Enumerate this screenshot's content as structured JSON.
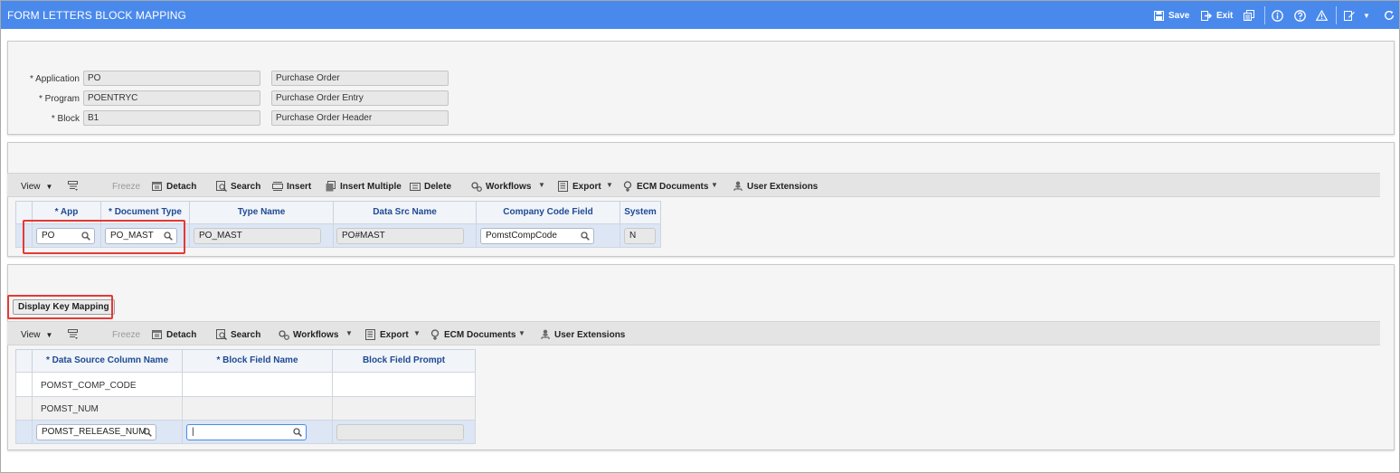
{
  "window": {
    "title": "FORM LETTERS BLOCK MAPPING",
    "save_label": "Save",
    "exit_label": "Exit"
  },
  "header_form": {
    "application_label": "* Application",
    "application_value": "PO",
    "application_desc": "Purchase Order",
    "program_label": "* Program",
    "program_value": "POENTRYC",
    "program_desc": "Purchase Order Entry",
    "block_label": "* Block",
    "block_value": "B1",
    "block_desc": "Purchase Order Header"
  },
  "toolbar1": {
    "view": "View",
    "freeze": "Freeze",
    "detach": "Detach",
    "search": "Search",
    "insert": "Insert",
    "insert_multiple": "Insert Multiple",
    "delete": "Delete",
    "workflows": "Workflows",
    "export": "Export",
    "ecm": "ECM Documents",
    "user_ext": "User Extensions"
  },
  "grid1": {
    "columns": [
      "* App",
      "* Document Type",
      "Type Name",
      "Data Src Name",
      "Company Code Field",
      "System"
    ],
    "row": {
      "app": "PO",
      "document_type": "PO_MAST",
      "type_name": "PO_MAST",
      "data_src_name": "PO#MAST",
      "company_code_field": "PomstCompCode",
      "system": "N"
    }
  },
  "display_key_mapping": "Display Key Mapping",
  "toolbar2": {
    "view": "View",
    "freeze": "Freeze",
    "detach": "Detach",
    "search": "Search",
    "workflows": "Workflows",
    "export": "Export",
    "ecm": "ECM Documents",
    "user_ext": "User Extensions"
  },
  "grid2": {
    "columns": [
      "* Data Source Column Name",
      "* Block Field Name",
      "Block Field Prompt"
    ],
    "rows": [
      {
        "col": "POMST_COMP_CODE",
        "field": "",
        "prompt": ""
      },
      {
        "col": "POMST_NUM",
        "field": "",
        "prompt": ""
      },
      {
        "col": "POMST_RELEASE_NUM",
        "field": "|",
        "prompt": ""
      }
    ]
  },
  "colors": {
    "titlebar": "#4a89ec",
    "header_text": "#1e4a93",
    "highlight": "#e53935"
  }
}
